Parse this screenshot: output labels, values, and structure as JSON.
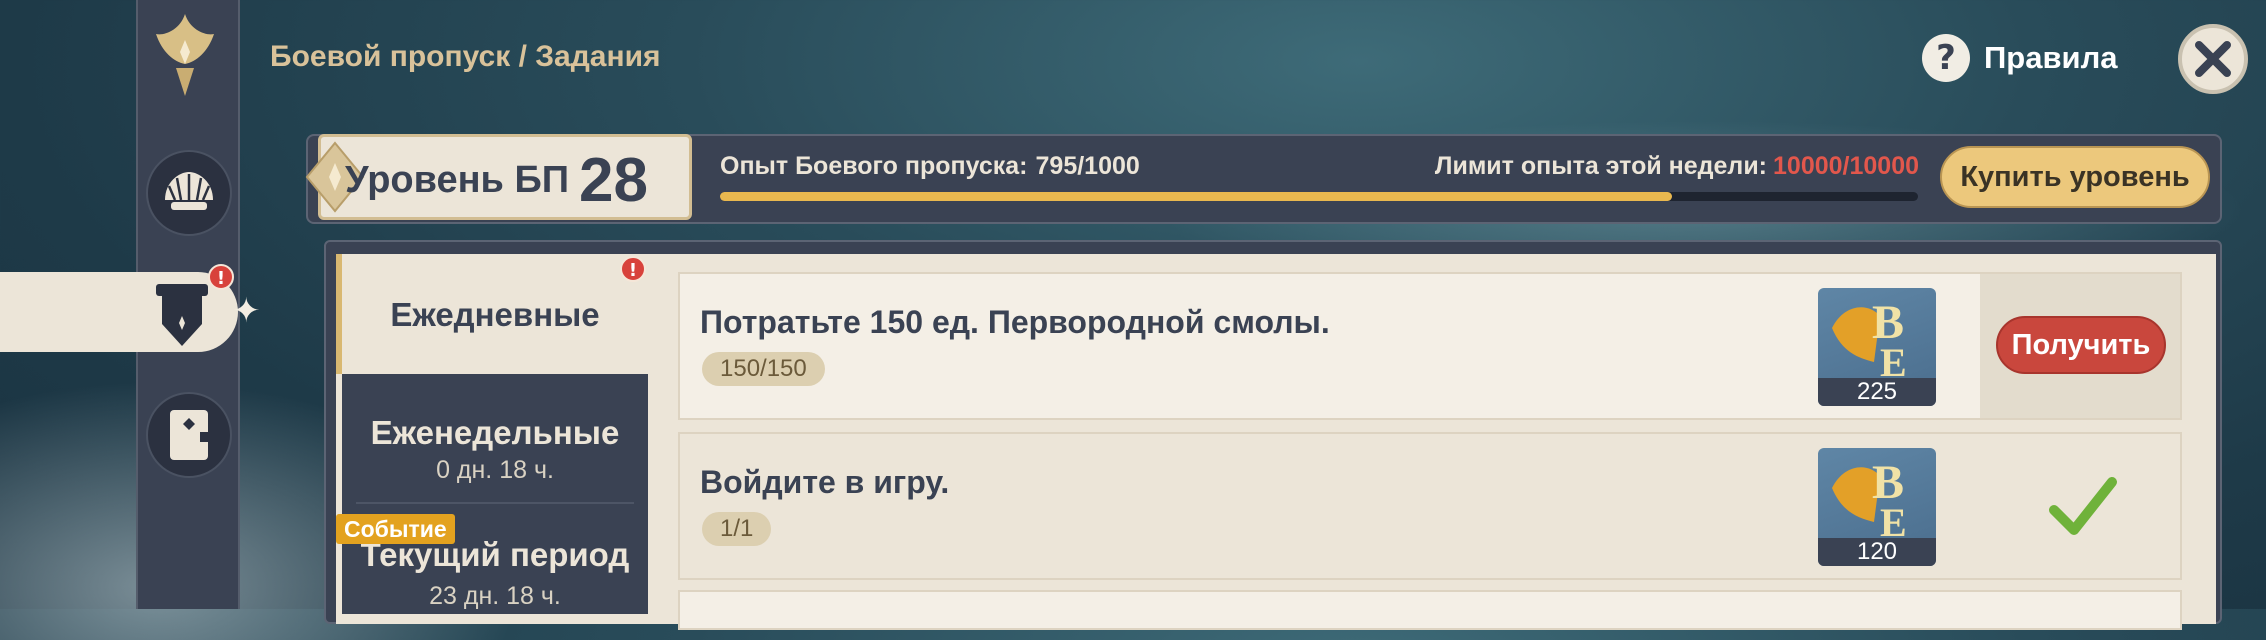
{
  "header": {
    "breadcrumb": "Боевой пропуск / Задания",
    "rules_icon": "?",
    "rules_label": "Правила",
    "close_icon": "close-icon"
  },
  "battlepass": {
    "level_label": "Уровень БП",
    "level": "28",
    "exp_label": "Опыт Боевого пропуска:",
    "exp_value": "795/1000",
    "exp_progress": 0.795,
    "weekly_label": "Лимит опыта этой недели:",
    "weekly_value": "10000/10000",
    "buy_button": "Купить уровень"
  },
  "sidebar": {
    "items": [
      {
        "icon": "emblem-icon"
      },
      {
        "icon": "shell-icon"
      },
      {
        "icon": "quest-shield-icon",
        "active": true,
        "alert": "!"
      },
      {
        "icon": "book-icon"
      }
    ]
  },
  "tabs": {
    "daily": {
      "label": "Ежедневные",
      "alert": "!"
    },
    "weekly": {
      "label": "Еженедельные",
      "sub": "0 дн. 18 ч."
    },
    "current": {
      "badge": "Событие",
      "label": "Текущий период",
      "sub": "23 дн. 18 ч."
    }
  },
  "tasks": [
    {
      "title": "Потратьте 150 ед. Первородной смолы.",
      "progress": "150/150",
      "reward": "225",
      "state": "claim",
      "action_label": "Получить"
    },
    {
      "title": "Войдите в игру.",
      "progress": "1/1",
      "reward": "120",
      "state": "done"
    }
  ],
  "colors": {
    "accent_gold": "#e9b84f",
    "claim_red": "#c9473d",
    "limit_red": "#e2574c",
    "panel_dark": "#3a4253",
    "panel_light": "#ece5d8",
    "check_green": "#6fb23a"
  }
}
